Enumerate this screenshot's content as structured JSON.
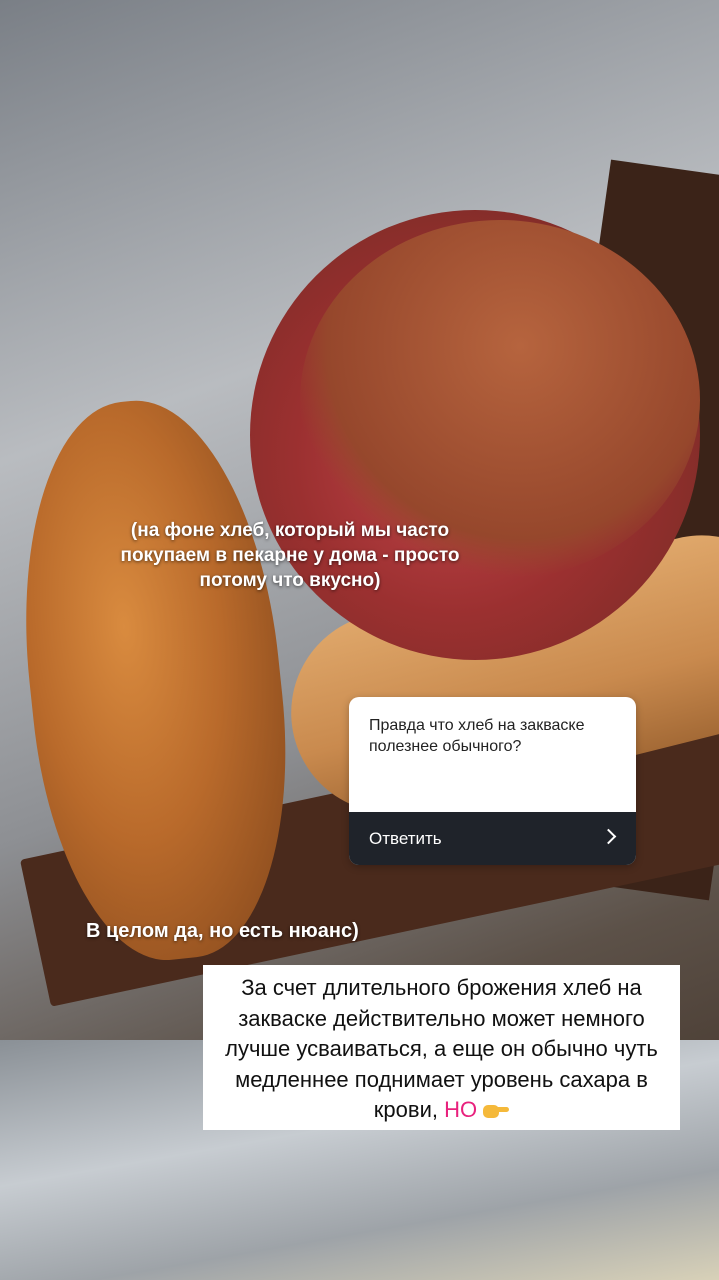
{
  "story": {
    "caption_top": "(на фоне хлеб, который мы часто покупаем в пекарне у дома - просто потому что вкусно)",
    "question_card": {
      "question": "Правда что хлеб на закваске полезнее обычного?",
      "answer_button": "Ответить"
    },
    "caption_mid": "В целом да, но есть нюанс)",
    "text_box": {
      "body": "За счет длительного брожения хлеб на закваске действительно может немного лучше усваиваться, а еще он обычно чуть медленнее поднимает уровень сахара в крови, ",
      "highlight": "НО",
      "highlight_color": "#e8217d",
      "emoji": "pointing-hand-icon"
    }
  }
}
